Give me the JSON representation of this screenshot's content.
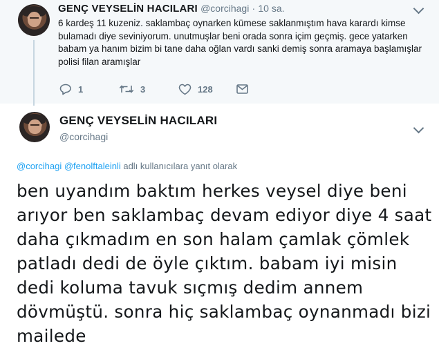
{
  "parent_tweet": {
    "name": "GENÇ VEYSELİN HACILARI",
    "handle": "@corcihagi",
    "separator": "·",
    "time": "10 sa.",
    "text": "6 kardeş 11 kuzeniz. saklambaç oynarken kümese saklanmıştım hava karardı kimse bulamadı diye seviniyorum. unutmuşlar beni orada sonra içim geçmiş. gece yatarken babam ya hanım bizim bi tane daha oğlan vardı sanki demiş sonra aramaya başlamışlar polisi filan aramışlar",
    "actions": {
      "reply_count": "1",
      "retweet_count": "3",
      "like_count": "128"
    }
  },
  "main_tweet": {
    "name": "GENÇ VEYSELİN HACILARI",
    "handle": "@corcihagi",
    "reply_to": {
      "mention_1": "@corcihagi",
      "mention_2": "@fenolftaleinli",
      "suffix": "adlı kullanıcılara yanıt olarak"
    },
    "text": "ben uyandım baktım herkes veysel diye beni arıyor ben saklambaç devam ediyor diye 4 saat daha çıkmadım en son halam çamlak çömlek patladı dedi de öyle çıktım. babam iyi misin dedi koluma tavuk sıçmış dedim annem dövmüştü. sonra hiç saklambaç oynanmadı bizi mailede"
  },
  "colors": {
    "link": "#1da1f2",
    "muted": "#657786",
    "thread_line": "#c7d6e0",
    "parent_bg": "#f5f8fa"
  },
  "icons": {
    "reply": "reply-icon",
    "retweet": "retweet-icon",
    "like": "heart-icon",
    "message": "envelope-icon",
    "menu": "chevron-down-icon"
  }
}
